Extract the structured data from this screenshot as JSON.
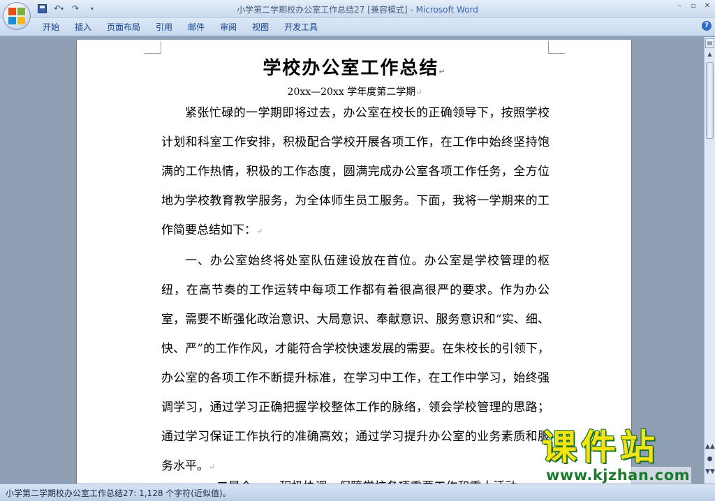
{
  "window": {
    "doc_name": "小学第二学期校办公室工作总结27 [兼容模式]",
    "separator": " - ",
    "app_name": "Microsoft Word"
  },
  "quick_access": {
    "save": "save-icon",
    "undo": "↶",
    "undo_more": "▾",
    "redo": "↷",
    "customize": "▾"
  },
  "window_controls": {
    "minimize": "–",
    "restore": "▫",
    "close": "✕"
  },
  "ribbon": {
    "tabs": [
      {
        "label": "开始"
      },
      {
        "label": "插入"
      },
      {
        "label": "页面布局"
      },
      {
        "label": "引用"
      },
      {
        "label": "邮件"
      },
      {
        "label": "审阅"
      },
      {
        "label": "视图"
      },
      {
        "label": "开发工具"
      }
    ],
    "help": "?"
  },
  "document": {
    "title": "学校办公室工作总结",
    "subtitle": "20xx—20xx 学年度第二学期",
    "paragraph_mark": "↵",
    "paragraphs": [
      "紧张忙碌的一学期即将过去，办公室在校长的正确领导下，按照学校计划和科室工作安排，积极配合学校开展各项工作，在工作中始终坚持饱满的工作热情，积极的工作态度，圆满完成办公室各项工作任务，全方位地为学校教育教学服务，为全体师生员工服务。下面，我将一学期来的工作简要总结如下：",
      "一、办公室始终将处室队伍建设放在首位。办公室是学校管理的枢纽，在高节奏的工作运转中每项工作都有着很高很严的要求。作为办公室，需要不断强化政治意识、大局意识、奉献意识、服务意识和“实、细、快、严”的工作作风，才能符合学校快速发展的需要。在朱校长的引领下，办公室的各项工作不断提升标准，在学习中工作，在工作中学习，始终强调学习，通过学习正确把握学校整体工作的脉络，领会学校管理的思路；通过学习保证工作执行的准确高效；通过学习提升办公室的业务素质和服务水平。"
    ],
    "partial_line": "二是合 一一积极协调，保障学校各项重要工作和重大活动"
  },
  "scrollbar": {
    "ruler": "▤",
    "up": "▲",
    "prev_page": "▲▲",
    "browse": "●",
    "next_page": "▼▼"
  },
  "status": {
    "text": "小学第二学期校办公室工作总结27: 1,128 个字符(近似值)。"
  },
  "watermark": {
    "title": "课件站",
    "url": "www.kjzhan.com"
  },
  "colors": {
    "title_app": "#3a63b4",
    "ribbon_text": "#15428b",
    "watermark_yellow": "#f2e313",
    "watermark_green": "#1a6e2e"
  }
}
